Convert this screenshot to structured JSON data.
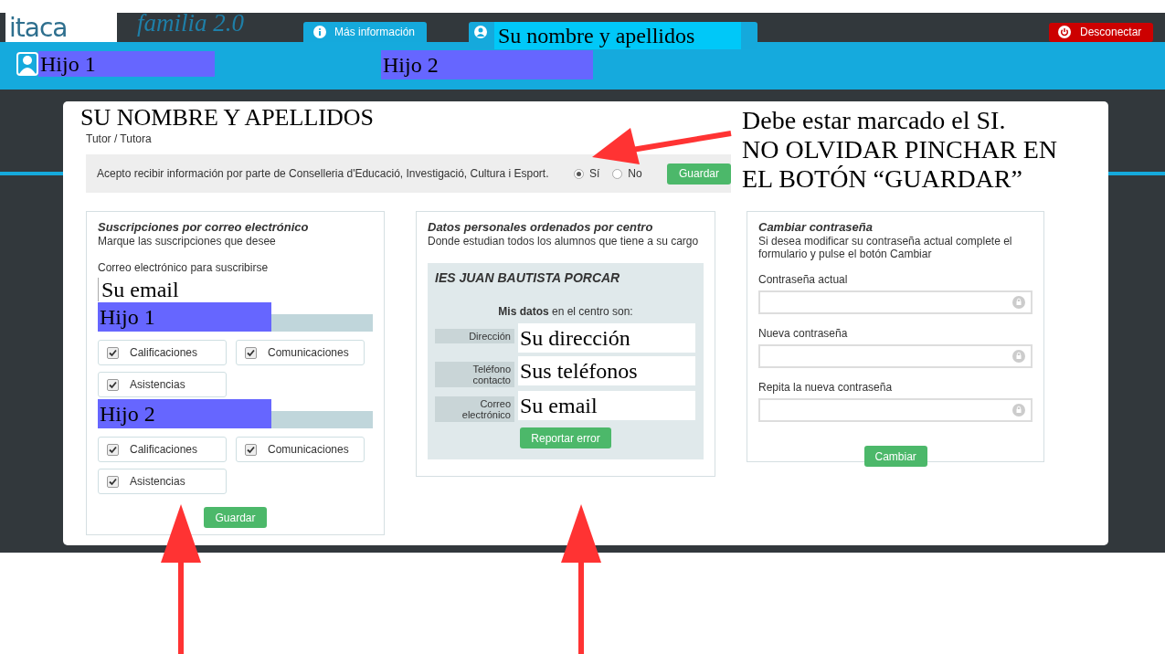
{
  "header": {
    "logo": "itaca",
    "app_name": "familia 2.0",
    "tabs": [
      {
        "kind": "info",
        "label": "Más información"
      },
      {
        "kind": "user",
        "label": "Su nombre y apellidos"
      }
    ],
    "logout": "Desconectar"
  },
  "students": [
    {
      "name": "Hijo 1",
      "kind": "icon"
    },
    {
      "name": "Hijo 2",
      "kind": "plain"
    }
  ],
  "profile": {
    "name": "SU NOMBRE Y APELLIDOS",
    "role": "Tutor / Tutora"
  },
  "consent": {
    "text": "Acepto recibir información por parte de Conselleria d'Educació, Investigació, Cultura i Esport.",
    "options": [
      {
        "label": "Sí",
        "selected": true
      },
      {
        "label": "No",
        "selected": false
      }
    ],
    "button": "Guardar"
  },
  "note": "Debe estar marcado el SI.\nNO OLVIDAR PINCHAR EN\nEL BOTÓN “GUARDAR”",
  "subscriptions": {
    "title": "Suscripciones por correo electrónico",
    "subtitle": "Marque las suscripciones que desee",
    "email_label": "Correo electrónico para suscribirse",
    "email_value": "Su email",
    "children": [
      {
        "name": "Hijo 1",
        "options": [
          {
            "label": "Calificaciones",
            "checked": true
          },
          {
            "label": "Comunicaciones",
            "checked": true
          },
          {
            "label": "Asistencias",
            "checked": true
          }
        ]
      },
      {
        "name": "Hijo 2",
        "options": [
          {
            "label": "Calificaciones",
            "checked": true
          },
          {
            "label": "Comunicaciones",
            "checked": true
          },
          {
            "label": "Asistencias",
            "checked": true
          }
        ]
      }
    ],
    "button": "Guardar"
  },
  "personal": {
    "title": "Datos personales ordenados por centro",
    "subtitle": "Donde estudian todos los alumnos que tiene a su cargo",
    "school": "IES JUAN BAUTISTA PORCAR",
    "intro": "**Mis datos** en el centro son:",
    "fields": [
      {
        "label": "Dirección",
        "value": "Su dirección"
      },
      {
        "label": "Teléfono contacto",
        "value": "Sus teléfonos"
      },
      {
        "label": "Correo electrónico",
        "value": "Su email"
      }
    ],
    "button": "Reportar error"
  },
  "password": {
    "title": "Cambiar contraseña",
    "description": "Si desea modificar su contraseña actual complete el formulario y pulse el botón Cambiar",
    "fields": [
      {
        "label": "Contraseña actual"
      },
      {
        "label": "Nueva contraseña"
      },
      {
        "label": "Repita la nueva contraseña"
      }
    ],
    "button": "Cambiar"
  }
}
